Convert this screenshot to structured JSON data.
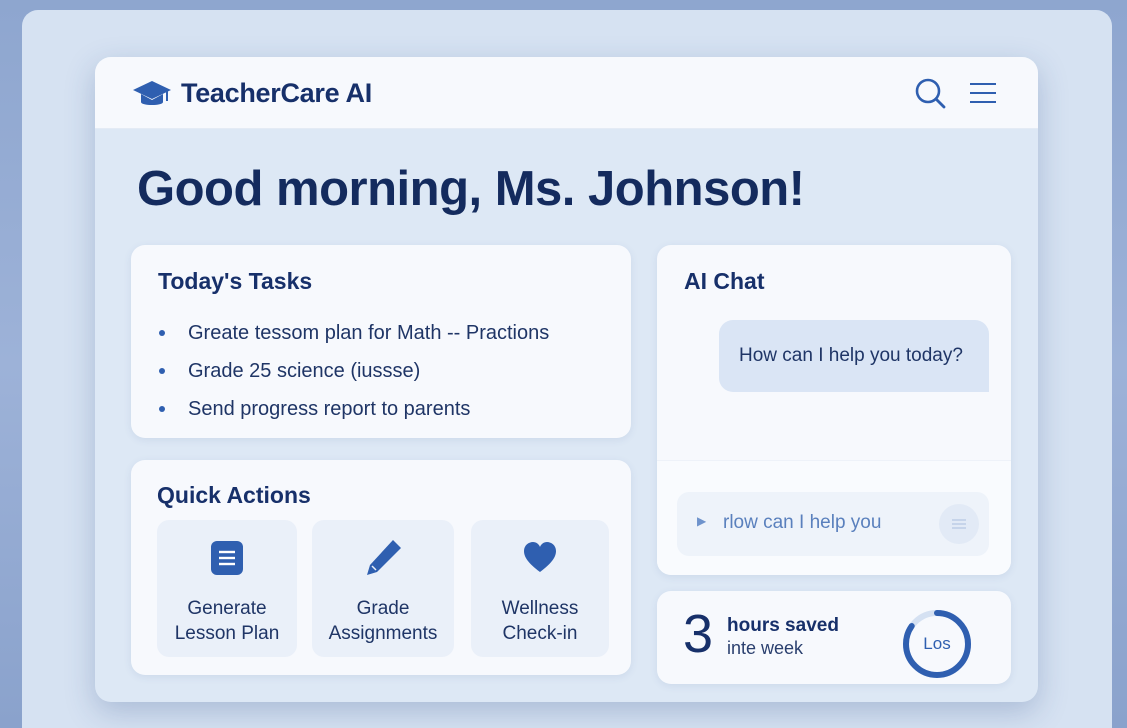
{
  "header": {
    "app_title": "TeacherCare AI",
    "logo_icon": "graduation-cap-icon",
    "search_icon": "search-icon",
    "menu_icon": "hamburger-menu-icon"
  },
  "greeting": "Good morning, Ms. Johnson!",
  "tasks": {
    "title": "Today's Tasks",
    "items": [
      "Greate tessom plan for Math -- Practions",
      "Grade 25 science (iussse)",
      "Send progress report to parents"
    ]
  },
  "quick_actions": {
    "title": "Quick Actions",
    "items": [
      {
        "label": "Generate\nLesson Plan",
        "icon": "document-list-icon"
      },
      {
        "label": "Grade\nAssignments",
        "icon": "pencil-icon"
      },
      {
        "label": "Wellness\nCheck-in",
        "icon": "heart-icon"
      }
    ]
  },
  "chat": {
    "title": "AI Chat",
    "bubble": "How can I help you today?",
    "input_placeholder": "rlow can I help you"
  },
  "stats": {
    "number": "3",
    "main": "hours saved",
    "sub": "inte week",
    "ring_label": "Los"
  },
  "colors": {
    "accent": "#2f5fb0",
    "title": "#17306a",
    "background": "#dde8f5"
  }
}
